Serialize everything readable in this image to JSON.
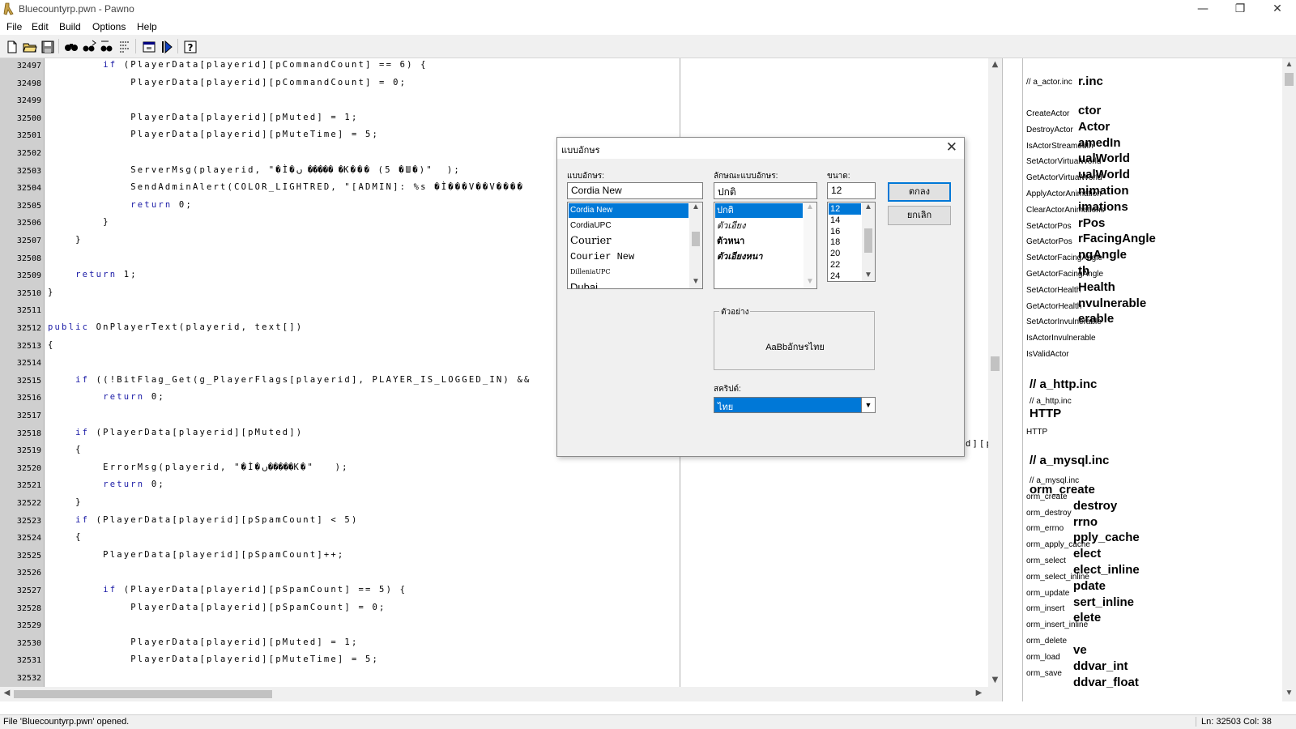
{
  "window": {
    "title": "Bluecountyrp.pwn - Pawno",
    "minimize": "—",
    "restore": "❐",
    "close": "✕"
  },
  "menu": [
    "File",
    "Edit",
    "Build",
    "Options",
    "Help"
  ],
  "toolbar": {
    "buttons": [
      "new-icon",
      "open-icon",
      "save-icon",
      "find-icon",
      "find-next-icon",
      "replace-icon",
      "goto-icon",
      "function-list-icon",
      "compile-icon",
      "help-icon"
    ]
  },
  "editor": {
    "lines": [
      {
        "num": "32497",
        "text": "        if (PlayerData[playerid][pCommandCount] == 6) {"
      },
      {
        "num": "32498",
        "text": "            PlayerData[playerid][pCommandCount] = 0;"
      },
      {
        "num": "32499",
        "text": ""
      },
      {
        "num": "32500",
        "text": "            PlayerData[playerid][pMuted] = 1;"
      },
      {
        "num": "32501",
        "text": "            PlayerData[playerid][pMuteTime] = 5;"
      },
      {
        "num": "32502",
        "text": ""
      },
      {
        "num": "32503",
        "text": "            ServerMsg(playerid, \"�Ì�ں ����� �K��� (5 �Ш�)\"  );"
      },
      {
        "num": "32504",
        "text": "            SendAdminAlert(COLOR_LIGHTRED, \"[ADMIN]: %s �Ì���V��V����"
      },
      {
        "num": "32505",
        "text": "            return 0;"
      },
      {
        "num": "32506",
        "text": "        }"
      },
      {
        "num": "32507",
        "text": "    }"
      },
      {
        "num": "32508",
        "text": ""
      },
      {
        "num": "32509",
        "text": "    return 1;"
      },
      {
        "num": "32510",
        "text": "}"
      },
      {
        "num": "32511",
        "text": ""
      },
      {
        "num": "32512",
        "text": "public OnPlayerText(playerid, text[])"
      },
      {
        "num": "32513",
        "text": "{"
      },
      {
        "num": "32514",
        "text": ""
      },
      {
        "num": "32515",
        "text": "    if ((!BitFlag_Get(g_PlayerFlags[playerid], PLAYER_IS_LOGGED_IN) &&"
      },
      {
        "num": "32516",
        "text": "        return 0;"
      },
      {
        "num": "32517",
        "text": ""
      },
      {
        "num": "32518",
        "text": "    if (PlayerData[playerid][pMuted])"
      },
      {
        "num": "32519",
        "text": "    {"
      },
      {
        "num": "32520",
        "text": "        ErrorMsg(playerid, \"�Ì�ں�����K�\"   );"
      },
      {
        "num": "32521",
        "text": "        return 0;"
      },
      {
        "num": "32522",
        "text": "    }"
      },
      {
        "num": "32523",
        "text": "    if (PlayerData[playerid][pSpamCount] < 5)"
      },
      {
        "num": "32524",
        "text": "    {"
      },
      {
        "num": "32525",
        "text": "        PlayerData[playerid][pSpamCount]++;"
      },
      {
        "num": "32526",
        "text": ""
      },
      {
        "num": "32527",
        "text": "        if (PlayerData[playerid][pSpamCount] == 5) {"
      },
      {
        "num": "32528",
        "text": "            PlayerData[playerid][pSpamCount] = 0;"
      },
      {
        "num": "32529",
        "text": ""
      },
      {
        "num": "32530",
        "text": "            PlayerData[playerid][pMuted] = 1;"
      },
      {
        "num": "32531",
        "text": "            PlayerData[playerid][pMuteTime] = 5;"
      },
      {
        "num": "32532",
        "text": ""
      }
    ],
    "overflow_right": "d][p"
  },
  "sidebar": {
    "items": [
      {
        "small": "// a_actor.inc",
        "big": "r.inc"
      },
      {
        "small": "CreateActor",
        "big": "ctor"
      },
      {
        "small": "DestroyActor",
        "big": "Actor"
      },
      {
        "small": "IsActorStreamedIn",
        "big": "amedIn"
      },
      {
        "small": "SetActorVirtualWorld",
        "big": "ualWorld"
      },
      {
        "small": "GetActorVirtualWorld",
        "big": "ualWorld"
      },
      {
        "small": "ApplyActorAnimation",
        "big": "nimation"
      },
      {
        "small": "ClearActorAnimations",
        "big": "imations"
      },
      {
        "small": "SetActorPos",
        "big": "rPos"
      },
      {
        "small": "GetActorPos",
        "big": "rFacingAngle"
      },
      {
        "small": "SetActorFacingAngle",
        "big": "ngAngle"
      },
      {
        "small": "GetActorFacingAngle",
        "big": "th"
      },
      {
        "small": "SetActorHealth",
        "big": "Health"
      },
      {
        "small": "GetActorHealth",
        "big": "nvulnerable"
      },
      {
        "small": "SetActorInvulnerable",
        "big": "erable"
      },
      {
        "small": "IsActorInvulnerable",
        "big": ""
      },
      {
        "small": "IsValidActor",
        "big": ""
      }
    ],
    "http_header": "// a_http.inc",
    "http_small": "// a_http.inc",
    "http_big": "HTTP",
    "http_item": "HTTP",
    "mysql_header": "// a_mysql.inc",
    "mysql_items": [
      {
        "small": "// a_mysql.inc",
        "big": "orm_create"
      },
      {
        "small": "orm_create",
        "big": "destroy"
      },
      {
        "small": "orm_destroy",
        "big": "rrno"
      },
      {
        "small": "orm_errno",
        "big": "pply_cache"
      },
      {
        "small": "orm_apply_cache",
        "big": "elect"
      },
      {
        "small": "orm_select",
        "big": "elect_inline"
      },
      {
        "small": "orm_select_inline",
        "big": "pdate"
      },
      {
        "small": "orm_update",
        "big": "sert_inline"
      },
      {
        "small": "orm_insert",
        "big": "elete"
      },
      {
        "small": "orm_insert_inline",
        "big": ""
      },
      {
        "small": "orm_delete",
        "big": "ve"
      },
      {
        "small": "orm_load",
        "big": "ddvar_int"
      },
      {
        "small": "orm_save",
        "big": "ddvar_float"
      }
    ]
  },
  "dialog": {
    "title": "แบบอักษร",
    "font_label": "แบบอักษร:",
    "font_value": "Cordia New",
    "fonts": [
      "Cordia New",
      "CordiaUPC",
      "Courier",
      "Courier New",
      "DilleniaUPC",
      "Dubai"
    ],
    "style_label": "ลักษณะแบบอักษร:",
    "style_value": "ปกติ",
    "styles": [
      "ปกติ",
      "ตัวเอียง",
      "ตัวหนา",
      "ตัวเอียงหนา"
    ],
    "size_label": "ขนาด:",
    "size_value": "12",
    "sizes": [
      "12",
      "14",
      "16",
      "18",
      "20",
      "22",
      "24"
    ],
    "ok": "ตกลง",
    "cancel": "ยกเลิก",
    "sample_label": "ตัวอย่าง",
    "sample_text": "AaBbอักษรไทย",
    "script_label": "สคริปต์:",
    "script_value": "ไทย"
  },
  "status": {
    "message": "File 'Bluecountyrp.pwn' opened.",
    "position": "Ln: 32503   Col: 38"
  },
  "colors": {
    "gutter": "#cfcfcf",
    "selection": "#000080",
    "keyword": "#1a1aa6",
    "accent": "#0078d7"
  }
}
